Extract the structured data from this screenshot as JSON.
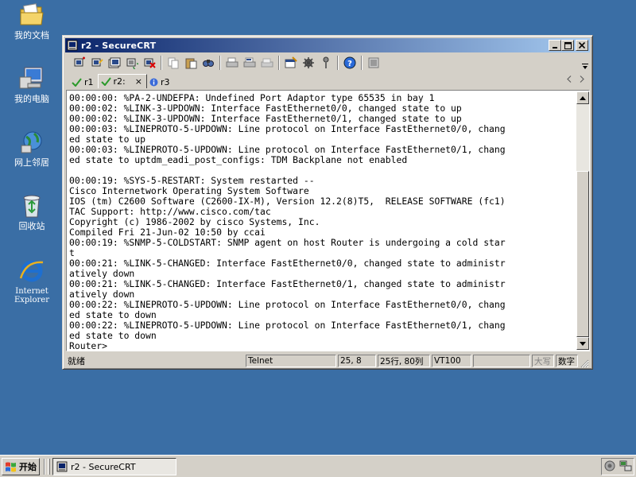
{
  "desktop": {
    "icons": [
      {
        "label": "我的文档",
        "icon": "folder-documents-icon"
      },
      {
        "label": "我的电脑",
        "icon": "computer-icon"
      },
      {
        "label": "网上邻居",
        "icon": "network-icon"
      },
      {
        "label": "回收站",
        "icon": "recycle-bin-icon"
      },
      {
        "label": "Internet",
        "label2": "Explorer",
        "icon": "internet-explorer-icon"
      }
    ]
  },
  "window": {
    "title": "r2 - SecureCRT",
    "controls": {
      "minimize": "_",
      "maximize": "□",
      "close": "×"
    }
  },
  "toolbar": {
    "icons": [
      "connect-icon",
      "quick-connect-icon",
      "connect-tab-icon",
      "reconnect-icon",
      "disconnect-icon",
      "copy-icon",
      "paste-icon",
      "find-icon",
      "print-icon",
      "print-selection-icon",
      "print-setup-icon",
      "session-options-icon",
      "global-options-icon",
      "keymap-icon",
      "help-icon",
      "sftp-icon"
    ]
  },
  "tabs": [
    {
      "label": "r1",
      "status": "connected",
      "active": false
    },
    {
      "label": "r2:",
      "status": "connected",
      "active": true,
      "close": "×"
    },
    {
      "label": "r3",
      "status": "info",
      "active": false
    }
  ],
  "terminal": {
    "lines": [
      "00:00:00: %PA-2-UNDEFPA: Undefined Port Adaptor type 65535 in bay 1",
      "00:00:02: %LINK-3-UPDOWN: Interface FastEthernet0/0, changed state to up",
      "00:00:02: %LINK-3-UPDOWN: Interface FastEthernet0/1, changed state to up",
      "00:00:03: %LINEPROTO-5-UPDOWN: Line protocol on Interface FastEthernet0/0, chang",
      "ed state to up",
      "00:00:03: %LINEPROTO-5-UPDOWN: Line protocol on Interface FastEthernet0/1, chang",
      "ed state to uptdm_eadi_post_configs: TDM Backplane not enabled",
      "",
      "00:00:19: %SYS-5-RESTART: System restarted --",
      "Cisco Internetwork Operating System Software",
      "IOS (tm) C2600 Software (C2600-IX-M), Version 12.2(8)T5,  RELEASE SOFTWARE (fc1)",
      "TAC Support: http://www.cisco.com/tac",
      "Copyright (c) 1986-2002 by cisco Systems, Inc.",
      "Compiled Fri 21-Jun-02 10:50 by ccai",
      "00:00:19: %SNMP-5-COLDSTART: SNMP agent on host Router is undergoing a cold star",
      "t",
      "00:00:21: %LINK-5-CHANGED: Interface FastEthernet0/0, changed state to administr",
      "atively down",
      "00:00:21: %LINK-5-CHANGED: Interface FastEthernet0/1, changed state to administr",
      "atively down",
      "00:00:22: %LINEPROTO-5-UPDOWN: Line protocol on Interface FastEthernet0/0, chang",
      "ed state to down",
      "00:00:22: %LINEPROTO-5-UPDOWN: Line protocol on Interface FastEthernet0/1, chang",
      "ed state to down",
      "Router>"
    ]
  },
  "statusbar": {
    "ready": "就绪",
    "protocol": "Telnet",
    "cursor": "25,  8",
    "size": "25行, 80列",
    "emulation": "VT100",
    "blank": "",
    "caps": "大写",
    "num": "数字"
  },
  "taskbar": {
    "start_label": "开始",
    "task_label": "r2 - SecureCRT"
  }
}
